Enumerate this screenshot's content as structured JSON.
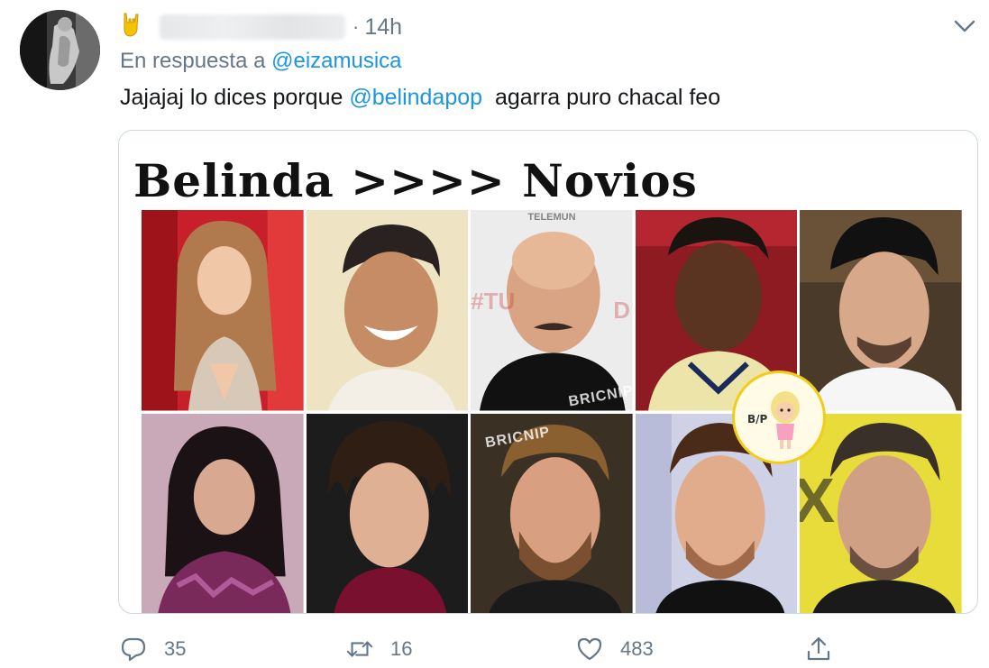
{
  "header": {
    "time": "14h",
    "separator": "·"
  },
  "reply": {
    "prefix": "En respuesta a ",
    "mention": "@eizamusica"
  },
  "tweet": {
    "text_before": "Jajajaj lo dices porque ",
    "mention": "@belindapop",
    "text_after": "  agarra puro chacal feo"
  },
  "media": {
    "title": "Belinda >>>> Novios",
    "watermarks": [
      "TELEMUN",
      "#TU",
      "D",
      "BRICNIPERRA",
      "BRICNIP",
      "X"
    ],
    "sticker_label": "B/P"
  },
  "actions": {
    "reply_count": "35",
    "retweet_count": "16",
    "like_count": "483"
  },
  "icons": {
    "emoji": "rock-on-hand-emoji",
    "caret": "chevron-down-icon",
    "reply": "reply-bubble-icon",
    "retweet": "retweet-icon",
    "like": "heart-icon",
    "share": "share-icon"
  },
  "colors": {
    "link": "#1b95e0",
    "secondary_text": "#657786",
    "border": "#ccd6dd"
  }
}
